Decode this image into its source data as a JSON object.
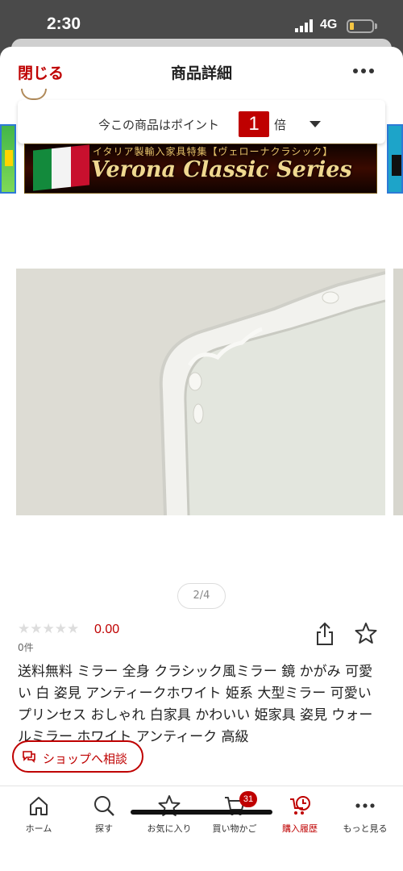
{
  "status_bar": {
    "time": "2:30",
    "network": "4G"
  },
  "header": {
    "close_label": "閉じる",
    "title": "商品詳細"
  },
  "points_banner": {
    "text": "今この商品はポイント",
    "multiplier": "1",
    "suffix": "倍"
  },
  "promo_banner": {
    "subtitle": "イタリア製輸入家具特集【ヴェローナクラシック】",
    "title": "Verona Classic Series"
  },
  "gallery": {
    "pager": "2/4"
  },
  "product": {
    "rating_value": "0.00",
    "review_count": "0件",
    "stars_filled": 0,
    "stars_total": 5,
    "title": "送料無料 ミラー 全身 クラシック風ミラー 鏡 かがみ 可愛い 白 姿見 アンティークホワイト 姫系 大型ミラー 可愛い プリンセス おしゃれ 白家具 かわいい 姫家具 姿見 ウォールミラー ホワイト アンティーク 高級"
  },
  "consult_button": {
    "label": "ショップへ相談"
  },
  "bottom_nav": {
    "items": [
      {
        "label": "ホーム",
        "icon": "home-icon"
      },
      {
        "label": "探す",
        "icon": "search-icon"
      },
      {
        "label": "お気に入り",
        "icon": "star-icon"
      },
      {
        "label": "買い物かご",
        "icon": "cart-icon",
        "badge": "31"
      },
      {
        "label": "購入履歴",
        "icon": "purchase-history-icon",
        "active": true
      },
      {
        "label": "もっと見る",
        "icon": "more-icon"
      }
    ]
  },
  "colors": {
    "accent": "#bf0000",
    "status_bar": "#4a4a4a"
  }
}
